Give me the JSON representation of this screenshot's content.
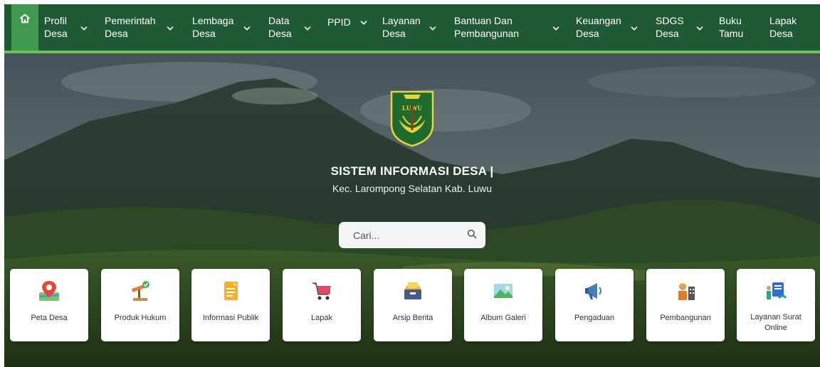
{
  "nav": {
    "home_icon": "home-icon",
    "items": [
      {
        "label": "Profil\nDesa",
        "dropdown": true
      },
      {
        "label": "Pemerintah\nDesa",
        "dropdown": true
      },
      {
        "label": "Lembaga\nDesa",
        "dropdown": true
      },
      {
        "label": "Data\nDesa",
        "dropdown": true
      },
      {
        "label": "PPID",
        "dropdown": true
      },
      {
        "label": "Layanan\nDesa",
        "dropdown": true
      },
      {
        "label": "Bantuan Dan\nPembangunan",
        "dropdown": true
      },
      {
        "label": "Keuangan\nDesa",
        "dropdown": true
      },
      {
        "label": "SDGS\nDesa",
        "dropdown": true
      },
      {
        "label": "Buku\nTamu",
        "dropdown": false
      },
      {
        "label": "Lapak\nDesa",
        "dropdown": false
      }
    ]
  },
  "hero": {
    "emblem_text": "LUWU",
    "title": "SISTEM INFORMASI DESA |",
    "subtitle": "Kec. Larompong Selatan Kab. Luwu",
    "search": {
      "placeholder": "Cari...",
      "icon": "search-icon"
    }
  },
  "cards": [
    {
      "label": "Peta Desa",
      "icon": "map-pin-icon"
    },
    {
      "label": "Produk Hukum",
      "icon": "gavel-icon"
    },
    {
      "label": "Informasi Publik",
      "icon": "document-icon"
    },
    {
      "label": "Lapak",
      "icon": "shopping-cart-icon"
    },
    {
      "label": "Arsip Berita",
      "icon": "archive-box-icon"
    },
    {
      "label": "Album Galeri",
      "icon": "image-gallery-icon"
    },
    {
      "label": "Pengaduan",
      "icon": "megaphone-icon"
    },
    {
      "label": "Pembangunan",
      "icon": "construction-worker-icon"
    },
    {
      "label": "Layanan Surat\nOnline",
      "icon": "mail-service-icon"
    }
  ],
  "colors": {
    "nav_bg": "#1f5a35",
    "nav_accent": "#6fbf5e",
    "home_bg": "#3f9a50"
  }
}
